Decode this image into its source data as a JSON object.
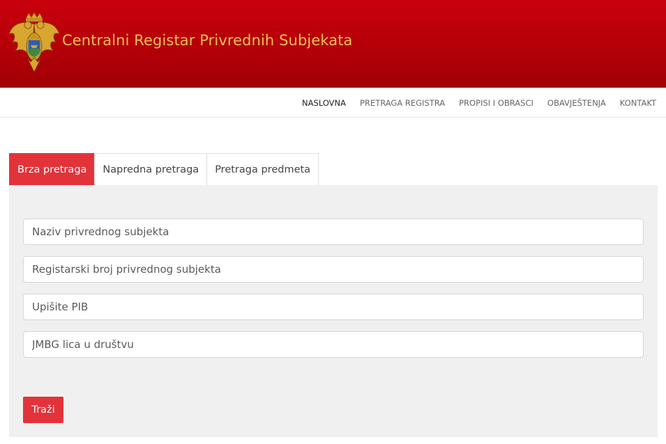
{
  "header": {
    "logo_icon": "montenegro-coat-of-arms-icon",
    "title": "Centralni Registar Privrednih Subjekata",
    "title_color": "#e9c05a",
    "background_color": "#b40008"
  },
  "nav": {
    "items": [
      {
        "label": "NASLOVNA",
        "active": true
      },
      {
        "label": "PRETRAGA REGISTRA",
        "active": false
      },
      {
        "label": "PROPISI I OBRASCI",
        "active": false
      },
      {
        "label": "OBAVJEŠTENJA",
        "active": false
      },
      {
        "label": "KONTAKT",
        "active": false
      }
    ]
  },
  "tabs": [
    {
      "label": "Brza pretraga",
      "active": true
    },
    {
      "label": "Napredna pretraga",
      "active": false
    },
    {
      "label": "Pretraga predmeta",
      "active": false
    }
  ],
  "form": {
    "fields": [
      {
        "placeholder": "Naziv privrednog subjekta",
        "value": ""
      },
      {
        "placeholder": "Registarski broj privrednog subjekta",
        "value": ""
      },
      {
        "placeholder": "Upišite PIB",
        "value": ""
      },
      {
        "placeholder": "JMBG lica u društvu",
        "value": ""
      }
    ],
    "submit_label": "Traži"
  },
  "colors": {
    "accent": "#e2333b",
    "panel_bg": "#f0f0f0"
  }
}
